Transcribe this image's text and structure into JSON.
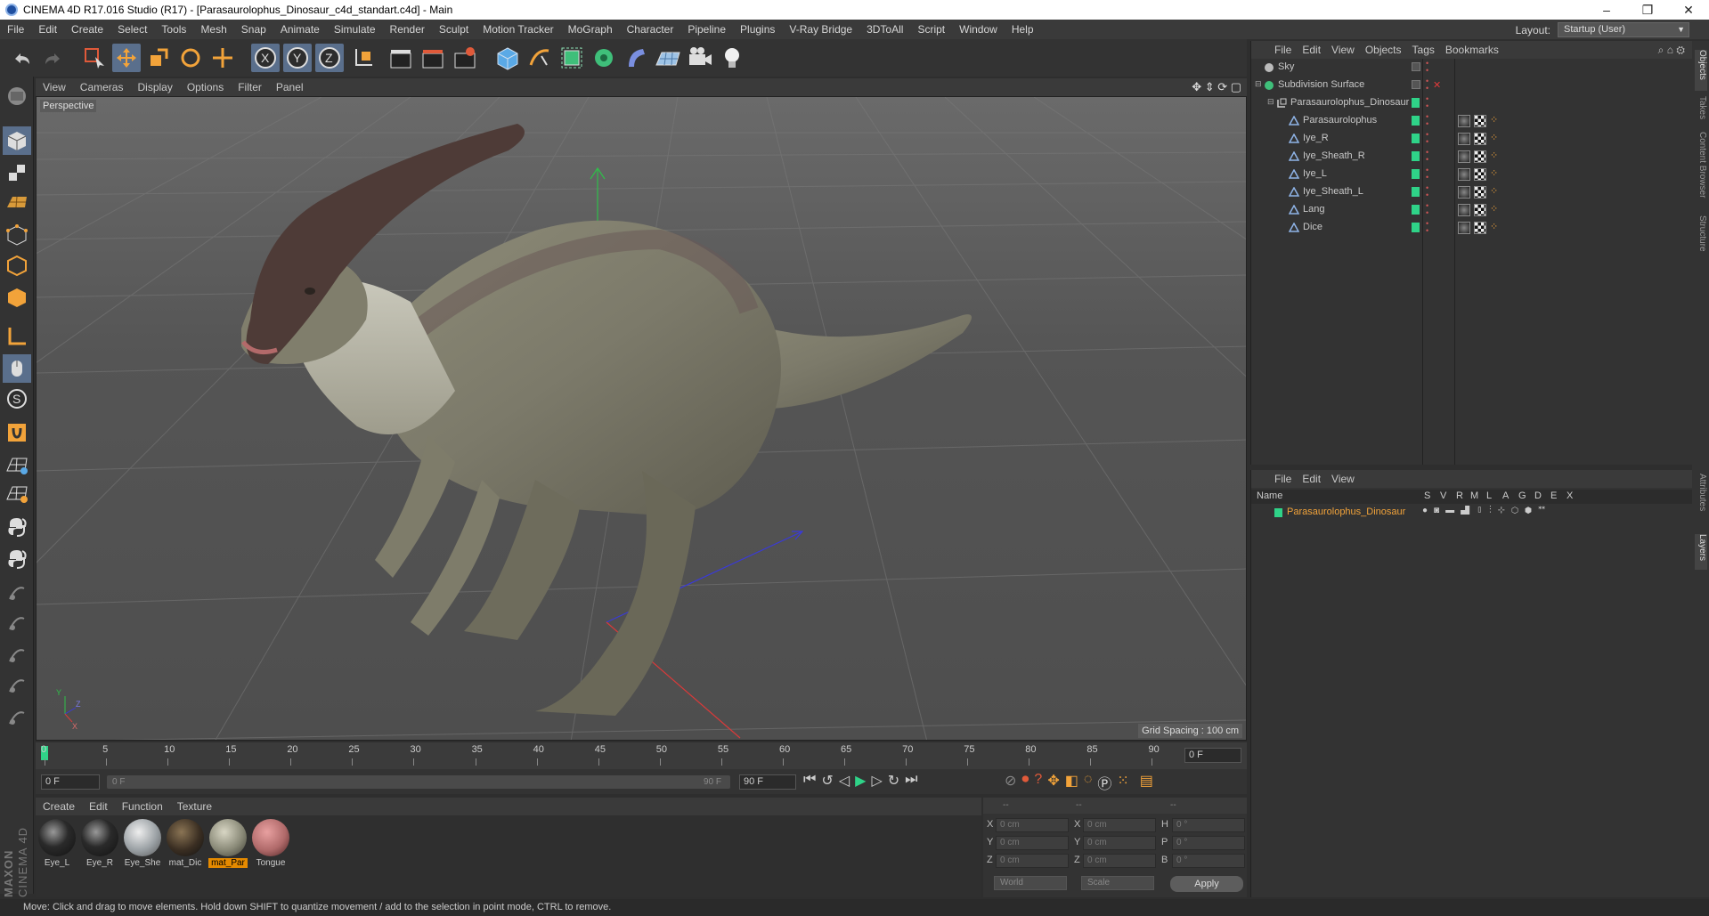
{
  "window": {
    "title": "CINEMA 4D R17.016 Studio (R17) - [Parasaurolophus_Dinosaur_c4d_standart.c4d] - Main",
    "minimize": "–",
    "maximize": "❐",
    "close": "✕"
  },
  "menubar": [
    "File",
    "Edit",
    "Create",
    "Select",
    "Tools",
    "Mesh",
    "Snap",
    "Animate",
    "Simulate",
    "Render",
    "Sculpt",
    "Motion Tracker",
    "MoGraph",
    "Character",
    "Pipeline",
    "Plugins",
    "V-Ray Bridge",
    "3DToAll",
    "Script",
    "Window",
    "Help"
  ],
  "layout": {
    "label": "Layout:",
    "value": "Startup (User)"
  },
  "viewport": {
    "menu": [
      "View",
      "Cameras",
      "Display",
      "Options",
      "Filter",
      "Panel"
    ],
    "label": "Perspective",
    "grid_spacing": "Grid Spacing : 100 cm"
  },
  "timeline": {
    "ticks": [
      "0",
      "5",
      "10",
      "15",
      "20",
      "25",
      "30",
      "35",
      "40",
      "45",
      "50",
      "55",
      "60",
      "65",
      "70",
      "75",
      "80",
      "85",
      "90"
    ],
    "current_frame": "0 F",
    "start_frame": "0 F",
    "range_start": "0 F",
    "range_end": "90 F",
    "end_frame": "90 F"
  },
  "materials": {
    "menu": [
      "Create",
      "Edit",
      "Function",
      "Texture"
    ],
    "items": [
      {
        "name": "Eye_L",
        "color": "#2a2a2a"
      },
      {
        "name": "Eye_R",
        "color": "#2a2a2a"
      },
      {
        "name": "Eye_She",
        "color": "#9aa0a4"
      },
      {
        "name": "mat_Dic",
        "color": "#3a2e22"
      },
      {
        "name": "mat_Par",
        "color": "#8a8a78"
      },
      {
        "name": "Tongue",
        "color": "#b06a6a"
      }
    ],
    "logo_top": "MAXON",
    "logo_bottom": "CINEMA 4D"
  },
  "coordinates": {
    "header_dashes": [
      "--",
      "--",
      "--"
    ],
    "rows": [
      {
        "l1": "X",
        "v1": "0 cm",
        "l2": "X",
        "v2": "0 cm",
        "l3": "H",
        "v3": "0 °"
      },
      {
        "l1": "Y",
        "v1": "0 cm",
        "l2": "Y",
        "v2": "0 cm",
        "l3": "P",
        "v3": "0 °"
      },
      {
        "l1": "Z",
        "v1": "0 cm",
        "l2": "Z",
        "v2": "0 cm",
        "l3": "B",
        "v3": "0 °"
      }
    ],
    "mode1": "World",
    "mode2": "Scale",
    "apply": "Apply"
  },
  "object_manager": {
    "menu": [
      "File",
      "Edit",
      "View",
      "Objects",
      "Tags",
      "Bookmarks"
    ],
    "objects": [
      {
        "name": "Sky",
        "indent": 0
      },
      {
        "name": "Subdivision Surface",
        "indent": 0
      },
      {
        "name": "Parasaurolophus_Dinosaur",
        "indent": 1
      },
      {
        "name": "Parasaurolophus",
        "indent": 2
      },
      {
        "name": "Iye_R",
        "indent": 2
      },
      {
        "name": "Iye_Sheath_R",
        "indent": 2
      },
      {
        "name": "Iye_L",
        "indent": 2
      },
      {
        "name": "Iye_Sheath_L",
        "indent": 2
      },
      {
        "name": "Lang",
        "indent": 2
      },
      {
        "name": "Dice",
        "indent": 2
      }
    ]
  },
  "layer_manager": {
    "menu": [
      "File",
      "Edit",
      "View"
    ],
    "columns": [
      "Name",
      "S",
      "V",
      "R",
      "M",
      "L",
      "A",
      "G",
      "D",
      "E",
      "X"
    ],
    "layer_name": "Parasaurolophus_Dinosaur",
    "layer_color": "#2fd388"
  },
  "side_tabs": [
    "Objects",
    "Takes",
    "Content Browser",
    "Structure",
    "Attributes",
    "Layers"
  ],
  "status": "Move: Click and drag to move elements. Hold down SHIFT to quantize movement / add to the selection in point mode, CTRL to remove.",
  "colors": {
    "accent_orange": "#e58a00",
    "active_blue": "#5a6f8c",
    "layer_green": "#2fd388"
  }
}
